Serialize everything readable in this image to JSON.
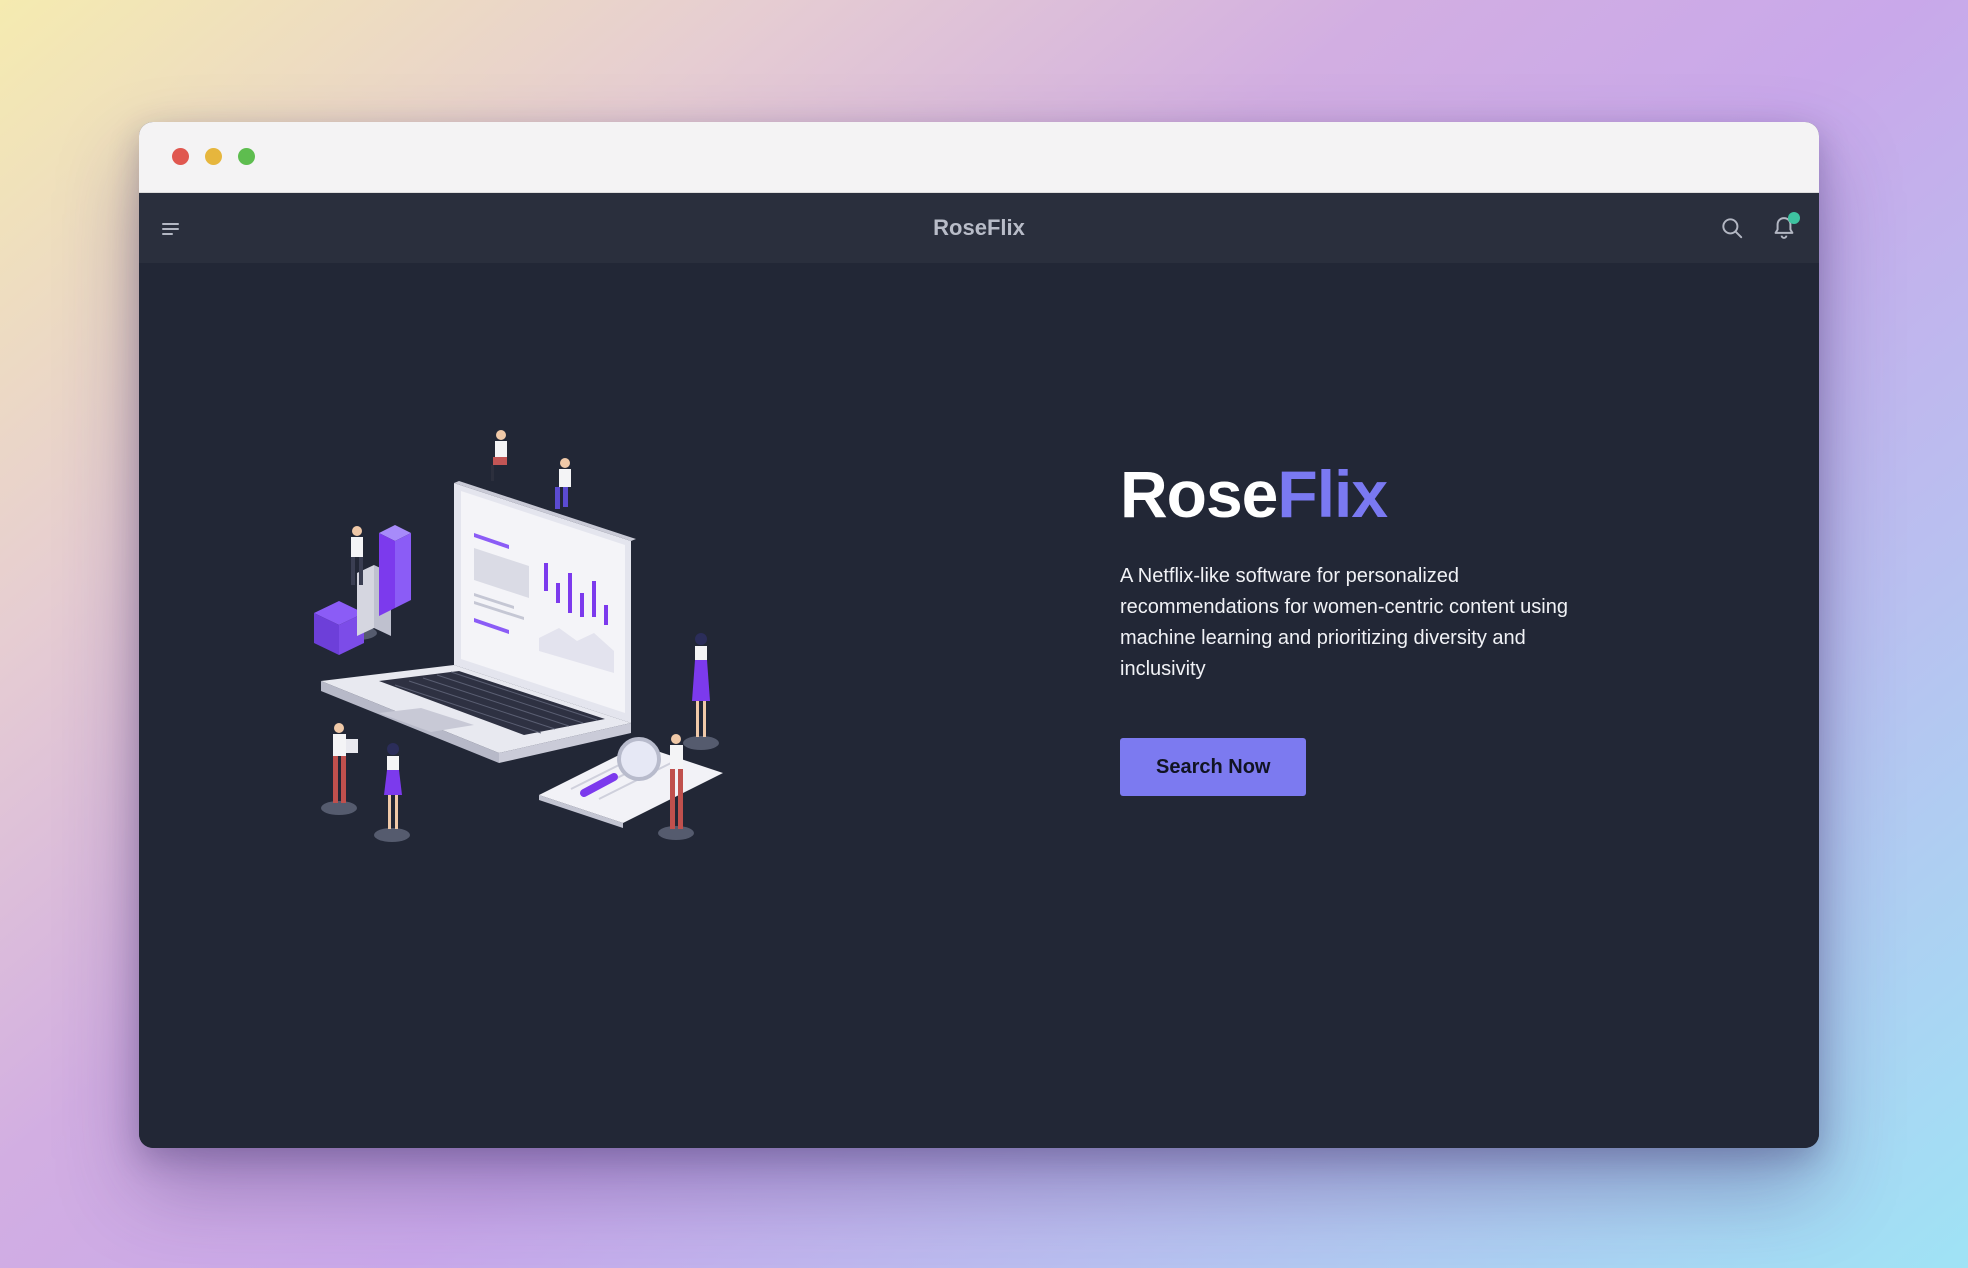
{
  "app": {
    "title": "RoseFlix"
  },
  "hero": {
    "title_part1": "Rose",
    "title_part2": "Flix",
    "description": "A Netflix-like software for personalized recommendations for women-centric content using machine learning and prioritizing diversity and inclusivity",
    "cta_label": "Search Now"
  },
  "icons": {
    "menu": "hamburger-menu-icon",
    "search": "search-icon",
    "notifications": "bell-icon"
  },
  "colors": {
    "accent": "#7c7af0",
    "notification_badge": "#3ec2a0",
    "app_background": "#222736",
    "appbar": "#2a2f3d"
  }
}
